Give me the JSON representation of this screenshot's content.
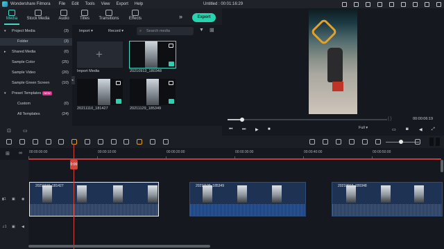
{
  "titlebar": {
    "app_name": "Wondershare Filmora",
    "menu": [
      "File",
      "Edit",
      "Tools",
      "View",
      "Export",
      "Help"
    ],
    "document_title": "Untitled : 00:01:16:29"
  },
  "toolbar": {
    "tabs": [
      {
        "label": "Media",
        "icon": "media-icon",
        "active": true
      },
      {
        "label": "Stock Media",
        "icon": "stock-media-icon",
        "active": false
      },
      {
        "label": "Audio",
        "icon": "audio-icon",
        "active": false
      },
      {
        "label": "Titles",
        "icon": "titles-icon",
        "active": false
      },
      {
        "label": "Transitions",
        "icon": "transitions-icon",
        "active": false
      },
      {
        "label": "Effects",
        "icon": "effects-icon",
        "active": false
      }
    ],
    "more": "»",
    "export_label": "Export"
  },
  "sidebar": {
    "items": [
      {
        "label": "Project Media",
        "count": "(3)",
        "expandable": true
      },
      {
        "label": "Folder",
        "count": "(3)",
        "selected": true
      },
      {
        "label": "Shared Media",
        "count": "(0)",
        "expandable": true
      },
      {
        "label": "Sample Color",
        "count": "(25)"
      },
      {
        "label": "Sample Video",
        "count": "(20)"
      },
      {
        "label": "Sample Green Screen",
        "count": "(10)"
      },
      {
        "label": "Preset Templates",
        "count": "",
        "expandable": true,
        "badge": "NEW"
      },
      {
        "label": "Custom",
        "count": "(0)"
      },
      {
        "label": "All Templates",
        "count": "(24)"
      }
    ]
  },
  "media": {
    "import_label": "Import",
    "record_label": "Record",
    "search_placeholder": "Search media",
    "import_tile_label": "Import Media",
    "thumbs": [
      {
        "name": "20210913_180348",
        "selected": true
      },
      {
        "name": "20211110_181427",
        "selected": false
      },
      {
        "name": "20211129_185349",
        "selected": false
      }
    ]
  },
  "preview": {
    "timecode": "00:00:06:19",
    "brackets": "{   }",
    "quality": "Full",
    "progress": 0.09
  },
  "ruler": {
    "labels": [
      "00:00:00:00",
      "00:00:10:00",
      "00:00:20:00",
      "00:00:30:00",
      "00:00:40:00",
      "00:00:50:00"
    ]
  },
  "timeline": {
    "playhead_label": "0:00",
    "clips": [
      {
        "name": "20211110_181427",
        "selected": true
      },
      {
        "name": "20211129_185349",
        "selected": false
      },
      {
        "name": "20210913_180348",
        "selected": false
      }
    ],
    "track_labels": [
      "1",
      "1"
    ]
  },
  "colors": {
    "accent": "#28d3b0",
    "playhead": "#d0453c",
    "clip": "#1e3354"
  }
}
